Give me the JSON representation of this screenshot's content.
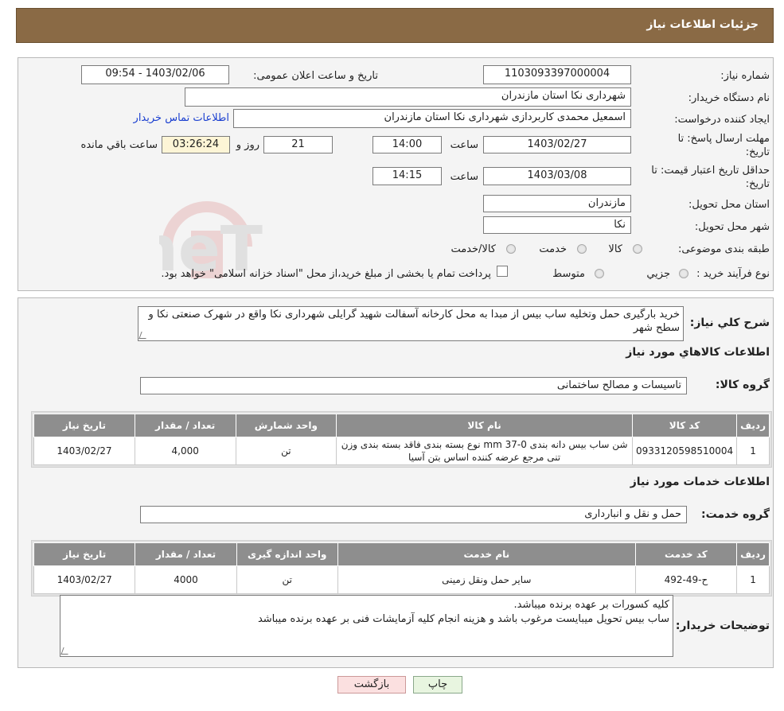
{
  "header": {
    "title": "جزئیات اطلاعات نیاز"
  },
  "watermark": {
    "text": "AriaTender.neT"
  },
  "info": {
    "need_number_label": "شماره نیاز:",
    "need_number": "1103093397000004",
    "announce_label": "تاریخ و ساعت اعلان عمومی:",
    "announce_value": "1403/02/06 - 09:54",
    "buyer_org_label": "نام دستگاه خریدار:",
    "buyer_org": "شهرداری نکا استان مازندران",
    "creator_label": "ایجاد کننده درخواست:",
    "creator": "اسمعیل محمدی کاربردازی شهرداری نکا استان مازندران",
    "contact_link": "اطلاعات تماس خریدار",
    "deadline_label_1": "مهلت ارسال پاسخ: تا",
    "deadline_label_2": "تاریخ:",
    "deadline_date": "1403/02/27",
    "time_label": "ساعت",
    "deadline_time": "14:00",
    "days_value": "21",
    "days_label": "روز و",
    "remaining_time": "03:26:24",
    "remaining_label": "ساعت باقي مانده",
    "validity_label_1": "حداقل تاریخ اعتبار قیمت: تا",
    "validity_label_2": "تاریخ:",
    "validity_date": "1403/03/08",
    "validity_time": "14:15",
    "province_label": "استان محل تحویل:",
    "province": "مازندران",
    "city_label": "شهر محل تحویل:",
    "city": "نکا",
    "category_label": "طبقه بندی موضوعی:",
    "category_options": [
      "کالا",
      "خدمت",
      "کالا/خدمت"
    ],
    "process_label": "نوع فرآیند خرید :",
    "process_options": [
      "جزیي",
      "متوسط"
    ],
    "process_note": "پرداخت تمام یا بخشی از مبلغ خرید،از محل \"اسناد خزانه اسلامی\" خواهد بود."
  },
  "description": {
    "label": "شرح کلي نياز:",
    "text": "خرید بارگیری حمل وتخلیه ساب بیس از مبدا به محل کارخانه آسفالت شهید گرایلی شهرداری نکا واقع در شهرک صنعتی نکا و سطح شهر"
  },
  "goods": {
    "section_title": "اطلاعات کالاهاي مورد نياز",
    "group_label": "گروه کالا:",
    "group_value": "تاسیسات و مصالح ساختمانی",
    "columns": [
      "رديف",
      "کد کالا",
      "نام کالا",
      "واحد شمارش",
      "تعداد / مقدار",
      "تاریخ نیاز"
    ],
    "rows": [
      [
        "1",
        "0933120598510004",
        "شن ساب بیس دانه بندی mm 37-0 نوع بسته بندی فاقد بسته بندی وزن تنی مرجع عرضه کننده اساس بتن آسیا",
        "تن",
        "4,000",
        "1403/02/27"
      ]
    ]
  },
  "services": {
    "section_title": "اطلاعات خدمات مورد نياز",
    "group_label": "گروه خدمت:",
    "group_value": "حمل و نقل و انبارداری",
    "columns": [
      "رديف",
      "کد خدمت",
      "نام خدمت",
      "واحد اندازه گیری",
      "تعداد / مقدار",
      "تاریخ نیاز"
    ],
    "rows": [
      [
        "1",
        "ح-49-492",
        "سایر حمل ونقل زمینی",
        "تن",
        "4000",
        "1403/02/27"
      ]
    ]
  },
  "buyer_notes": {
    "label": "توضیحات خریدار:",
    "line1": "کلیه کسورات بر عهده برنده میباشد.",
    "line2": "ساب بیس تحویل میبایست مرغوب باشد و هزینه انجام کلیه آزمایشات فنی بر عهده برنده میباشد"
  },
  "buttons": {
    "print": "چاپ",
    "back": "بازگشت"
  }
}
